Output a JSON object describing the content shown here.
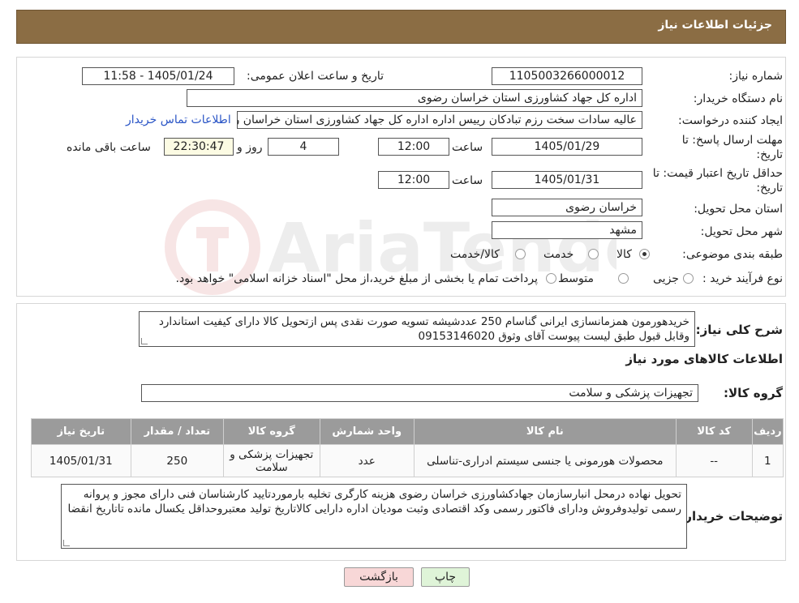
{
  "header": {
    "title": "جزئیات اطلاعات نیاز"
  },
  "fields": {
    "need_number_label": "شماره نیاز:",
    "need_number": "1105003266000012",
    "announce_label": "تاریخ و ساعت اعلان عمومی:",
    "announce_value": "1405/01/24 - 11:58",
    "buyer_label": "نام دستگاه خریدار:",
    "buyer_value": "اداره کل جهاد کشاورزی استان خراسان رضوی",
    "creator_label": "ایجاد کننده درخواست:",
    "creator_value": "عالیه سادات سخت رزم تبادکان رییس اداره  اداره کل جهاد کشاورزی استان خراسان رضوی",
    "contact_link": "اطلاعات تماس خریدار",
    "deadline_label_1": "مهلت ارسال پاسخ: تا",
    "deadline_label_2": "تاریخ:",
    "deadline_date": "1405/01/29",
    "time_label": "ساعت",
    "deadline_time": "12:00",
    "days_value": "4",
    "days_label": "روز و",
    "remaining_value": "22:30:47",
    "remaining_label": "ساعت باقی مانده",
    "validity_label_1": "حداقل تاریخ اعتبار قیمت: تا",
    "validity_label_2": "تاریخ:",
    "validity_date": "1405/01/31",
    "validity_time": "12:00",
    "province_label": "استان محل تحویل:",
    "province_value": "خراسان رضوی",
    "city_label": "شهر محل تحویل:",
    "city_value": "مشهد",
    "category_label": "طبقه بندی موضوعی:",
    "category_options": [
      "کالا",
      "خدمت",
      "کالا/خدمت"
    ],
    "category_selected": "کالا",
    "process_label": "نوع فرآیند خرید :",
    "process_options": [
      "جزیی",
      "متوسط"
    ],
    "process_note": "پرداخت تمام یا بخشی از مبلغ خرید،از محل \"اسناد خزانه اسلامی\" خواهد بود."
  },
  "summary": {
    "label": "شرح کلی نیاز:",
    "text": "خریدهورمون همزمانسازی ایرانی گناسام 250 عددشیشه تسویه صورت نقدی پس ازتحویل کالا دارای کیفیت استاندارد وقابل قبول طبق لیست پیوست آقای وثوق 09153146020"
  },
  "goods_section": {
    "title": "اطلاعات کالاهای مورد نیاز",
    "group_label": "گروه کالا:",
    "group_value": "تجهیزات پزشکی و سلامت"
  },
  "table": {
    "headers": [
      "ردیف",
      "کد کالا",
      "نام کالا",
      "واحد شمارش",
      "گروه کالا",
      "تعداد / مقدار",
      "تاریخ نیاز"
    ],
    "rows": [
      [
        "1",
        "--",
        "محصولات هورمونی یا جنسی سیستم ادراری-تناسلی",
        "عدد",
        "تجهیزات پزشکی و سلامت",
        "250",
        "1405/01/31"
      ]
    ]
  },
  "buyer_notes": {
    "label": "توضیحات خریدار:",
    "text": "تحویل نهاده درمحل انبارسازمان جهادکشاورزی خراسان رضوی هزینه کارگری تخلیه بارموردتایید کارشناسان فنی  دارای مجوز و پروانه رسمی تولیدوفروش ودارای فاکتور رسمی وکد اقتصادی وثبت مودیان اداره دارایی کالاتاریخ تولید معتبروحداقل یکسال مانده تاتاریخ انقضا"
  },
  "buttons": {
    "print": "چاپ",
    "back": "بازگشت"
  },
  "colors": {
    "title_bg": "#8b6d44",
    "table_header_bg": "#9b9b9b",
    "back_btn_bg": "#f8d7d7",
    "print_btn_bg": "#dff4d8",
    "link": "#2a55c6"
  }
}
